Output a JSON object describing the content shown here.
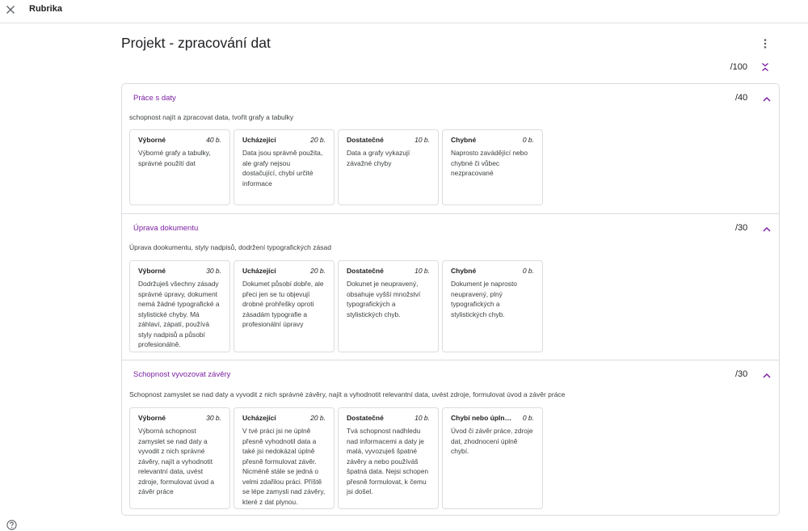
{
  "topbar": {
    "title": "Rubrika"
  },
  "page": {
    "title": "Projekt - zpracování dat",
    "total": "/100"
  },
  "colors": {
    "accent": "#7b1fa2",
    "border": "#dadce0",
    "text": "#202124",
    "muted": "#3c4043"
  },
  "icons": {
    "close": "close-icon",
    "more": "more-vert-icon",
    "collapse_all": "unfold-less-icon",
    "collapse": "chevron-up-icon",
    "help": "help-icon"
  },
  "criteria": [
    {
      "title": "Práce s daty",
      "points": "/40",
      "description": "schopnost najít a zpracovat data, tvořit grafy a tabulky",
      "levels": [
        {
          "name": "Výborné",
          "points": "40 b.",
          "description": "Výborné grafy a tabulky, správné použití dat"
        },
        {
          "name": "Ucházející",
          "points": "20 b.",
          "description": "Data jsou správně použita, ale grafy nejsou dostačující, chybí určité informace"
        },
        {
          "name": "Dostatečné",
          "points": "10 b.",
          "description": "Data a grafy vykazují závažné chyby"
        },
        {
          "name": "Chybné",
          "points": "0 b.",
          "description": "Naprosto zavádějící nebo chybné či vůbec nezpracované"
        }
      ]
    },
    {
      "title": "Úprava dokumentu",
      "points": "/30",
      "description": "Úprava dookumentu, styly nadpisů, dodržení typografických zásad",
      "levels": [
        {
          "name": "Výborné",
          "points": "30 b.",
          "description": "Dodržuješ všechny zásady správné úpravy, dokument nemá žádné typografické a stylistické chyby. Má záhlaví, zápatí, používá styly nadpisů a působí profesionálně."
        },
        {
          "name": "Ucházející",
          "points": "20 b.",
          "description": "Dokumet působí dobře, ale přeci jen se tu objevují drobné prohřešky oproti zásadám typografie a profesionální úpravy"
        },
        {
          "name": "Dostatečné",
          "points": "10 b.",
          "description": "Dokunet je neupravený, obsahuje vyšší množství typografických a stylistických chyb."
        },
        {
          "name": "Chybné",
          "points": "0 b.",
          "description": "Dokument je naprosto neupravený, plný typografických a stylistických chyb."
        }
      ]
    },
    {
      "title": "Schopnost vyvozovat závěry",
      "points": "/30",
      "description": "Schopnost zamyslet se nad daty a vyvodit z nich správné závěry, najít a vyhodnotit relevantní data, uvést zdroje, formulovat úvod a závěr práce",
      "levels": [
        {
          "name": "Výborné",
          "points": "30 b.",
          "description": "Výborná schopnost zamyslet se nad daty a vyvodit z nich správné závěry, najít a vyhodnotit relevantní data, uvést zdroje, formulovat úvod a závěr práce"
        },
        {
          "name": "Ucházející",
          "points": "20 b.",
          "description": "V tvé práci jsi ne úplně přesně vyhodnotil data a také jsi nedokázal úplně přesně formulovat závěr. Nicméně stále se jedná o velmi zdařilou práci. Příště se lépe zamysli nad závěry, které z dat plynou."
        },
        {
          "name": "Dostatečné",
          "points": "10 b.",
          "description": "Tvá schopnost nadhledu nad informacemi a daty je malá, vyvozuješ špatné závěry a nebo používáš špatná data. Nejsi schopen přesně formulovat, k čemu jsi došel."
        },
        {
          "name": "Chybí nebo úplně š…",
          "points": "0 b.",
          "description": "Úvod či závěr práce, zdroje dat, zhodnocení úplně chybí."
        }
      ]
    }
  ]
}
